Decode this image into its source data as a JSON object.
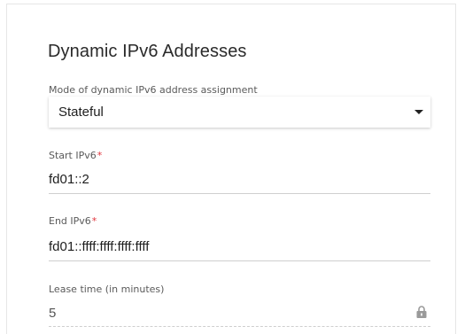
{
  "section": {
    "title": "Dynamic IPv6 Addresses"
  },
  "mode": {
    "label": "Mode of dynamic IPv6 address assignment",
    "value": "Stateful",
    "icon": "chevron-down-icon"
  },
  "start_ipv6": {
    "label": "Start IPv6",
    "required_mark": "*",
    "value": "fd01::2"
  },
  "end_ipv6": {
    "label": "End IPv6",
    "required_mark": "*",
    "value": "fd01::ffff:ffff:ffff:ffff"
  },
  "lease_time": {
    "label": "Lease time (in minutes)",
    "value": "5",
    "icon": "lock-icon",
    "locked": true
  },
  "colors": {
    "required": "#e0323a",
    "text": "#1e1e1e",
    "label": "#5a5a5a",
    "underline": "#cfcfcf"
  }
}
